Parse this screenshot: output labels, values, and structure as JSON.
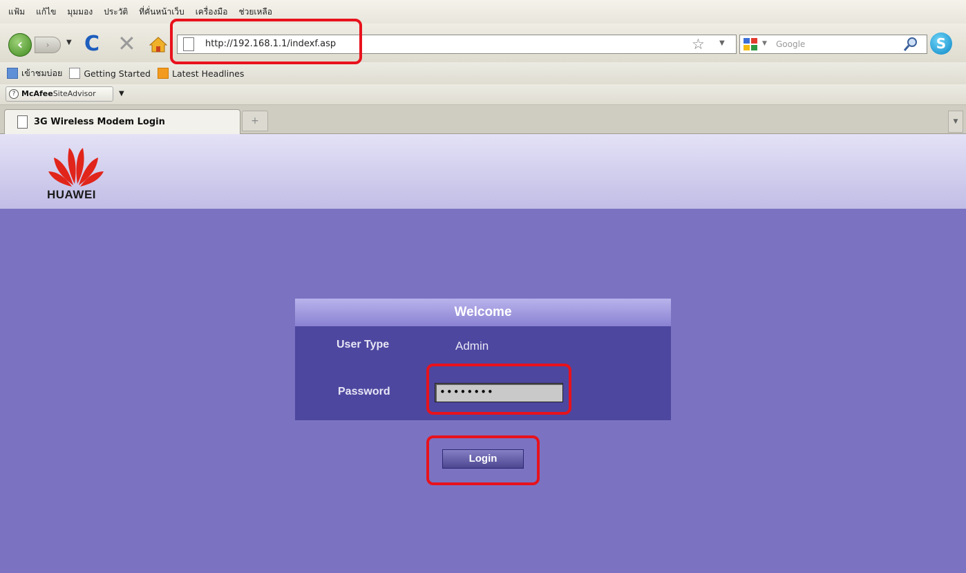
{
  "menu": [
    "แฟ้ม",
    "แก้ไข",
    "มุมมอง",
    "ประวัติ",
    "ที่คั่นหน้าเว็บ",
    "เครื่องมือ",
    "ช่วยเหลือ"
  ],
  "address": {
    "url": "http://192.168.1.1/indexf.asp"
  },
  "search": {
    "placeholder": "Google"
  },
  "bookmarks": [
    "เข้าชมบ่อย",
    "Getting Started",
    "Latest Headlines"
  ],
  "addon": {
    "brand": "McAfee",
    "suffix": "SiteAdvisor"
  },
  "tab": {
    "title": "3G Wireless Modem Login",
    "new_tab": "+"
  },
  "brand": {
    "logo_text": "HUAWEI"
  },
  "login": {
    "title": "Welcome",
    "user_type_label": "User Type",
    "user_type_value": "Admin",
    "password_label": "Password",
    "password_value": "••••••••",
    "button_label": "Login"
  },
  "colors": {
    "page_bg": "#7b73c1",
    "panel_bg": "#4d479f",
    "highlight": "#e8121c"
  }
}
